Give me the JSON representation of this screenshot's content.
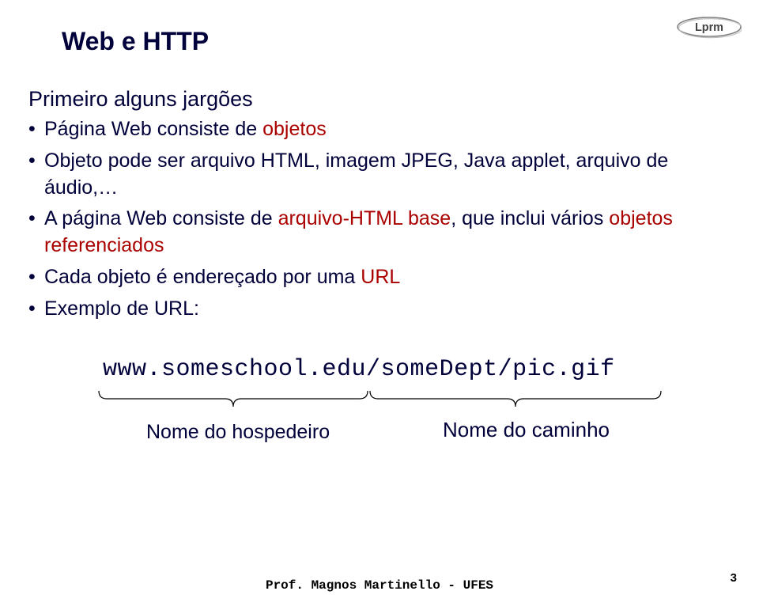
{
  "title": "Web e HTTP",
  "subheading": "Primeiro alguns jargões",
  "bullets": {
    "b0_pre": "Página Web consiste de ",
    "b0_obj": "objetos",
    "b1": "Objeto pode ser arquivo HTML, imagem JPEG, Java applet, arquivo de áudio,…",
    "b2_pre": "A página Web consiste de ",
    "b2_accent": "arquivo-HTML base",
    "b2_post": ", que inclui vários ",
    "b2_accent2": "objetos referenciados",
    "b3_pre": "Cada objeto é endereçado por uma ",
    "b3_accent": "URL",
    "b4": "Exemplo de URL:"
  },
  "url": "www.someschool.edu/someDept/pic.gif",
  "host_label": "Nome do hospedeiro",
  "path_label": "Nome do caminho",
  "footer": "Prof. Magnos Martinello - UFES",
  "page_number": "3",
  "logo_text": "Lprm"
}
